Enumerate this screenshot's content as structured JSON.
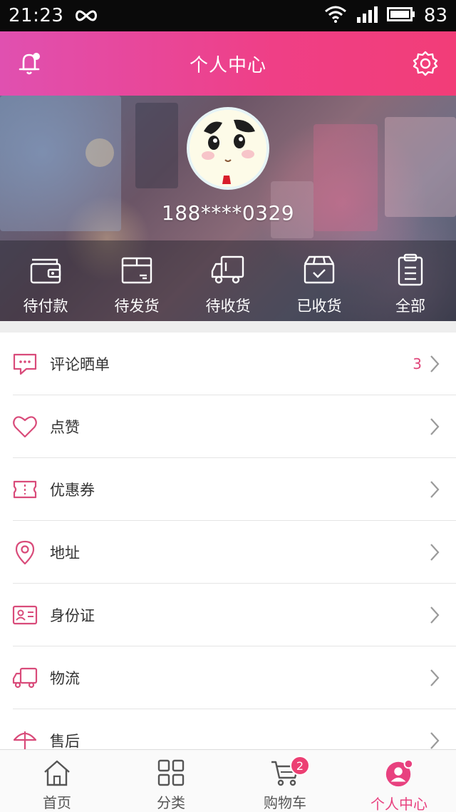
{
  "status_bar": {
    "time": "21:23",
    "battery": "83",
    "icons": [
      "infinity-icon",
      "wifi-icon",
      "signal-icon",
      "battery-icon"
    ]
  },
  "header": {
    "title": "个人中心",
    "left_icon": "notification-bell-icon",
    "right_icon": "gear-icon",
    "gradient_colors": [
      "#e050b0",
      "#f23d78"
    ]
  },
  "profile": {
    "phone": "188****0329",
    "avatar_icon": "cartoon-avatar-icon"
  },
  "orders": [
    {
      "label": "待付款",
      "icon": "wallet-icon"
    },
    {
      "label": "待发货",
      "icon": "package-icon"
    },
    {
      "label": "待收货",
      "icon": "truck-icon"
    },
    {
      "label": "已收货",
      "icon": "received-box-icon"
    },
    {
      "label": "全部",
      "icon": "clipboard-icon"
    }
  ],
  "menu": [
    {
      "label": "评论晒单",
      "count": "3",
      "icon": "comment-icon"
    },
    {
      "label": "点赞",
      "count": "",
      "icon": "heart-icon"
    },
    {
      "label": "优惠券",
      "count": "",
      "icon": "coupon-icon"
    },
    {
      "label": "地址",
      "count": "",
      "icon": "location-pin-icon"
    },
    {
      "label": "身份证",
      "count": "",
      "icon": "id-card-icon"
    },
    {
      "label": "物流",
      "count": "",
      "icon": "truck-icon"
    },
    {
      "label": "售后",
      "count": "",
      "icon": "umbrella-icon"
    }
  ],
  "bottom_nav": [
    {
      "label": "首页",
      "icon": "home-icon",
      "active": false
    },
    {
      "label": "分类",
      "icon": "grid-icon",
      "active": false
    },
    {
      "label": "购物车",
      "icon": "cart-icon",
      "active": false,
      "badge": "2"
    },
    {
      "label": "个人中心",
      "icon": "user-icon",
      "active": true
    }
  ],
  "colors": {
    "accent": "#e8417f",
    "menu_icon": "#d94b7a"
  }
}
